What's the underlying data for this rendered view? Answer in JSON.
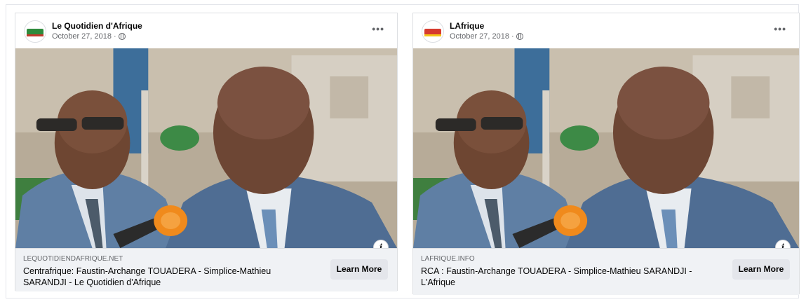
{
  "posts": [
    {
      "page_name": "Le Quotidien d'Afrique",
      "date": "October 27, 2018",
      "separator": "·",
      "more_label": "•••",
      "domain": "LEQUOTIDIENDAFRIQUE.NET",
      "headline": "Centrafrique: Faustin-Archange TOUADERA - Simplice-Mathieu SARANDJI - Le Quotidien d'Afrique",
      "cta_label": "Learn More",
      "info_label": "i",
      "avatar_colors": [
        "#2e8b3c",
        "#c0392b"
      ]
    },
    {
      "page_name": "LAfrique",
      "date": "October 27, 2018",
      "separator": "·",
      "more_label": "•••",
      "domain": "LAFRIQUE.INFO",
      "headline": "RCA : Faustin-Archange TOUADERA - Simplice-Mathieu SARANDJI - L'Afrique",
      "cta_label": "Learn More",
      "info_label": "i",
      "avatar_colors": [
        "#d63a2e",
        "#f5c518"
      ]
    }
  ]
}
